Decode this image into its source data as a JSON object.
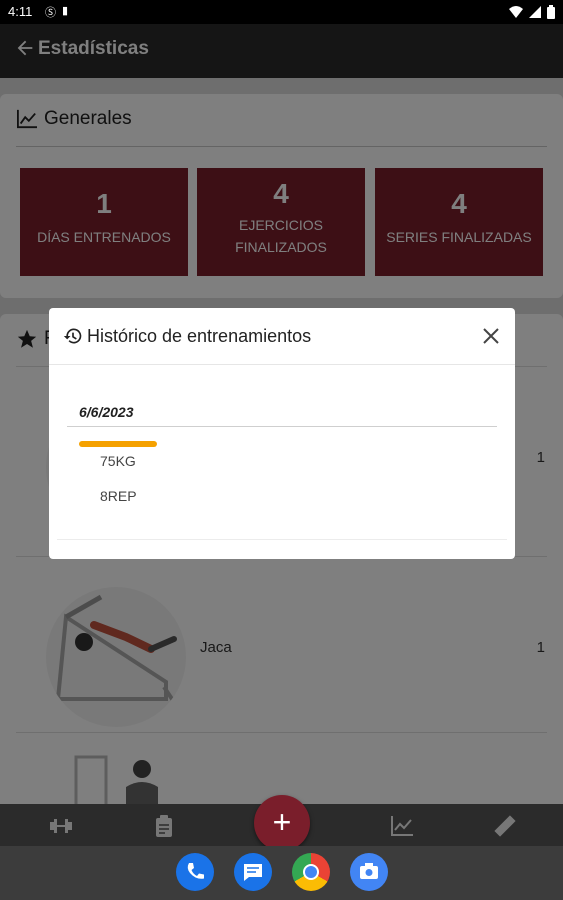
{
  "status_bar": {
    "time": "4:11",
    "icons": [
      "s-icon",
      "sd-card-icon",
      "wifi-icon",
      "signal-icon",
      "battery-icon"
    ]
  },
  "app_bar": {
    "title": "Estadísticas",
    "back_icon": "arrow-back-icon"
  },
  "generales": {
    "title": "Generales",
    "stats": [
      {
        "value": "1",
        "label": "DÍAS ENTRENADOS"
      },
      {
        "value": "4",
        "label": "EJERCICIOS FINALIZADOS"
      },
      {
        "value": "4",
        "label": "SERIES FINALIZADAS"
      }
    ]
  },
  "favorites": {
    "title": "F",
    "rows": [
      {
        "name": "",
        "count": "1"
      },
      {
        "name": "Jaca",
        "count": "1"
      }
    ]
  },
  "modal": {
    "title": "Histórico de entrenamientos",
    "date": "6/6/2023",
    "weight": "75KG",
    "reps": "8REP"
  },
  "bottom_nav": {
    "items": [
      "dumbbell-icon",
      "clipboard-icon",
      "add-icon",
      "chart-icon",
      "ruler-icon"
    ],
    "fab_label": "+"
  },
  "dock": {
    "apps": [
      "phone-app",
      "messages-app",
      "chrome-app",
      "camera-app"
    ]
  },
  "colors": {
    "accent": "#7a1e2b",
    "progress": "#f5a100",
    "appbar": "#2a2a2a"
  }
}
